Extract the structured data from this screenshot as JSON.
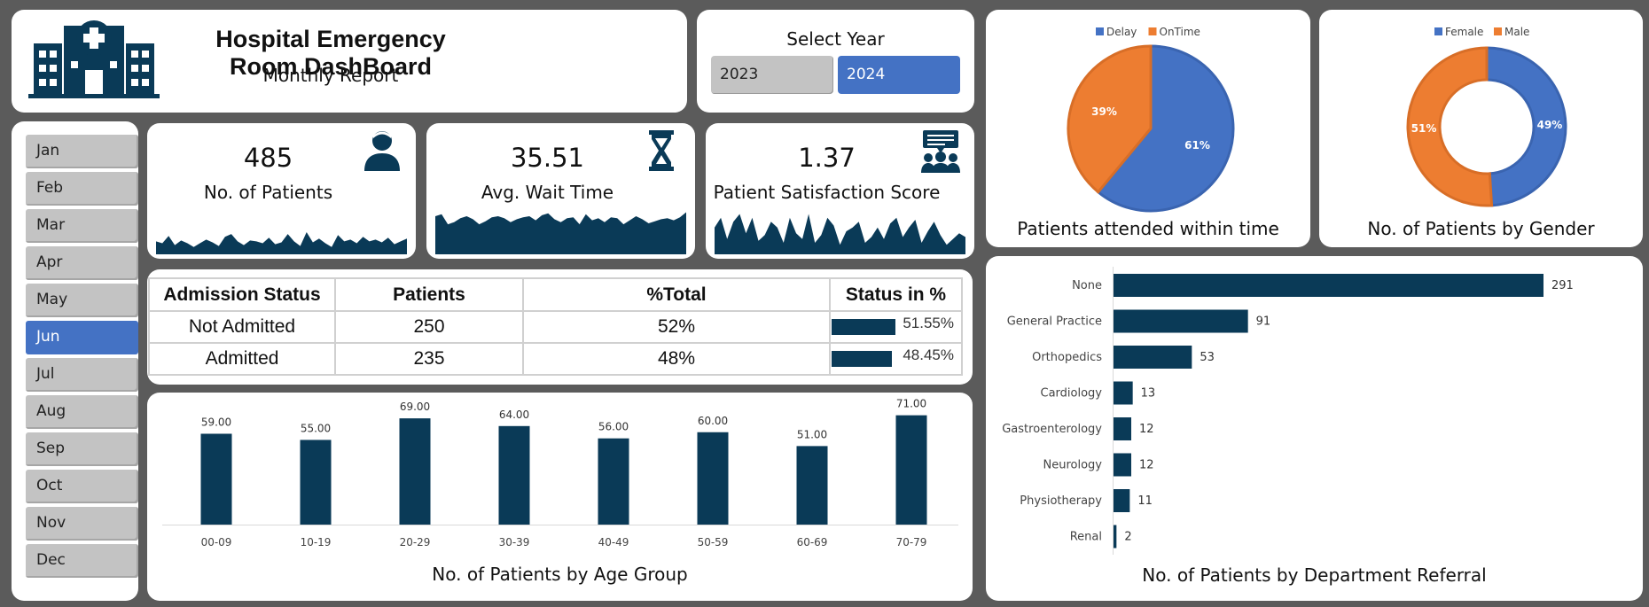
{
  "header": {
    "title": "Hospital Emergency Room DashBoard",
    "subtitle": "Monthly Report",
    "logo_icon": "hospital-building-icon"
  },
  "year_selector": {
    "title": "Select Year",
    "options": [
      "2023",
      "2024"
    ],
    "selected": "2024"
  },
  "months": {
    "items": [
      "Jan",
      "Feb",
      "Mar",
      "Apr",
      "May",
      "Jun",
      "Jul",
      "Aug",
      "Sep",
      "Oct",
      "Nov",
      "Dec"
    ],
    "selected": "Jun"
  },
  "kpis": [
    {
      "value": "485",
      "label": "No. of Patients",
      "icon": "patient-icon"
    },
    {
      "value": "35.51",
      "label": "Avg. Wait Time",
      "icon": "hourglass-icon"
    },
    {
      "value": "1.37",
      "label": "Patient Satisfaction Score",
      "icon": "feedback-group-icon"
    }
  ],
  "admission_table": {
    "headers": [
      "Admission Status",
      "Patients",
      "%Total",
      "Status in %"
    ],
    "rows": [
      {
        "status": "Not Admitted",
        "patients": "250",
        "pct_total": "52%",
        "status_pct": "51.55%",
        "fraction": 0.5155
      },
      {
        "status": "Admitted",
        "patients": "235",
        "pct_total": "48%",
        "status_pct": "48.45%",
        "fraction": 0.4845
      }
    ]
  },
  "colors": {
    "navy": "#0a3a57",
    "blue": "#4472c4",
    "orange": "#ed7d31",
    "button_gray": "#c3c3c3"
  },
  "chart_data": [
    {
      "id": "age",
      "type": "bar",
      "title": "No. of Patients by Age Group",
      "categories": [
        "00-09",
        "10-19",
        "20-29",
        "30-39",
        "40-49",
        "50-59",
        "60-69",
        "70-79"
      ],
      "values": [
        59,
        55,
        69,
        64,
        56,
        60,
        51,
        71
      ],
      "value_labels": [
        "59.00",
        "55.00",
        "69.00",
        "64.00",
        "56.00",
        "60.00",
        "51.00",
        "71.00"
      ],
      "ylim": [
        0,
        80
      ],
      "grid": false
    },
    {
      "id": "dept",
      "type": "bar",
      "orientation": "horizontal",
      "title": "No. of Patients by Department Referral",
      "categories": [
        "None",
        "General Practice",
        "Orthopedics",
        "Cardiology",
        "Gastroenterology",
        "Neurology",
        "Physiotherapy",
        "Renal"
      ],
      "values": [
        291,
        91,
        53,
        13,
        12,
        12,
        11,
        2
      ],
      "xlim": [
        0,
        291
      ]
    },
    {
      "id": "time",
      "type": "pie",
      "title": "Patients attended within time",
      "labels": [
        "Delay",
        "OnTime"
      ],
      "values": [
        61,
        39
      ],
      "value_labels": [
        "61%",
        "39%"
      ],
      "legend": "top"
    },
    {
      "id": "gender",
      "type": "pie",
      "subtype": "donut",
      "title": "No. of Patients by Gender",
      "labels": [
        "Female",
        "Male"
      ],
      "values": [
        49,
        51
      ],
      "value_labels": [
        "49%",
        "51%"
      ],
      "legend": "top"
    }
  ],
  "sparklines": {
    "patients": [
      14,
      12,
      20,
      10,
      15,
      12,
      8,
      12,
      16,
      13,
      9,
      19,
      22,
      14,
      10,
      15,
      14,
      12,
      18,
      11,
      13,
      22,
      14,
      9,
      24,
      13,
      17,
      12,
      8,
      21,
      14,
      16,
      12,
      19,
      14,
      16,
      13,
      18,
      11,
      14,
      17
    ],
    "wait_time": [
      38,
      40,
      30,
      32,
      36,
      38,
      35,
      30,
      33,
      37,
      38,
      36,
      32,
      35,
      37,
      38,
      34,
      39,
      41,
      35,
      32,
      36,
      37,
      30,
      40,
      34,
      36,
      32,
      37,
      36,
      30,
      34,
      38,
      35,
      31,
      33,
      35,
      36,
      34,
      37,
      42
    ],
    "satisfaction": [
      28,
      38,
      16,
      34,
      42,
      22,
      38,
      14,
      20,
      34,
      28,
      12,
      38,
      22,
      16,
      42,
      12,
      20,
      38,
      30,
      10,
      24,
      28,
      34,
      12,
      18,
      28,
      16,
      32,
      38,
      18,
      28,
      36,
      12,
      24,
      34,
      20,
      10,
      16,
      22,
      18
    ]
  }
}
